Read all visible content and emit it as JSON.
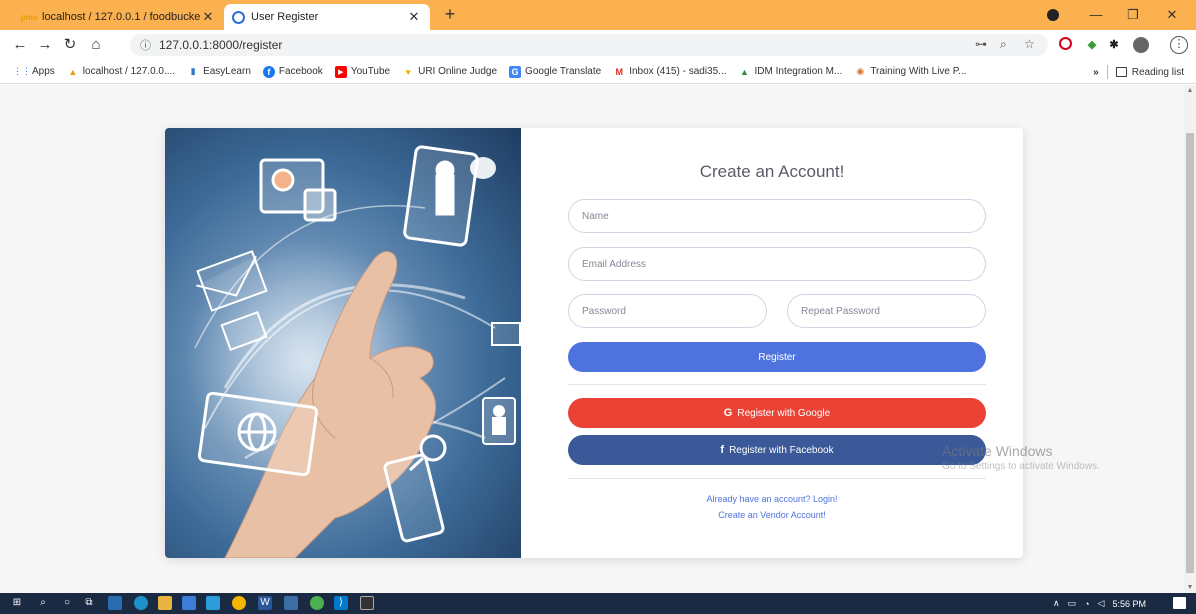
{
  "browser": {
    "tabs": [
      {
        "favicon": "phpmyadmin-icon",
        "favicon_text": "pma",
        "title": "localhost / 127.0.0.1 / foodbucke",
        "close": "✕"
      },
      {
        "favicon": "user-register-icon",
        "title": "User Register",
        "close": "✕"
      }
    ],
    "new_tab": "+",
    "window_controls": {
      "minimize": "—",
      "restore": "❐",
      "close": "✕"
    },
    "url": "127.0.0.1:8000/register",
    "url_info_icon": "ⓘ",
    "bookmarks": [
      {
        "label": "Apps",
        "icon": "apps-grid-icon",
        "glyph": "⋮⋮",
        "color": "#1a73e8"
      },
      {
        "label": "localhost / 127.0.0....",
        "icon": "phpmyadmin-icon",
        "glyph": "▲",
        "color": "#e8a000"
      },
      {
        "label": "EasyLearn",
        "icon": "easylearn-icon",
        "glyph": "▮",
        "color": "#2b78c5"
      },
      {
        "label": "Facebook",
        "icon": "facebook-icon",
        "glyph": "f",
        "color": "#1877f2"
      },
      {
        "label": "YouTube",
        "icon": "youtube-icon",
        "glyph": "▶",
        "color": "#ff0000"
      },
      {
        "label": "URI Online Judge",
        "icon": "uri-judge-icon",
        "glyph": "♥",
        "color": "#f4b400"
      },
      {
        "label": "Google Translate",
        "icon": "google-translate-icon",
        "glyph": "G",
        "color": "#4285f4"
      },
      {
        "label": "Inbox (415) - sadi35...",
        "icon": "gmail-icon",
        "glyph": "M",
        "color": "#d93025"
      },
      {
        "label": "IDM Integration M...",
        "icon": "idm-icon",
        "glyph": "▲",
        "color": "#2f8f3e"
      },
      {
        "label": "Training With Live P...",
        "icon": "training-icon",
        "glyph": "◉",
        "color": "#e07020"
      }
    ],
    "bookmarks_overflow": "»",
    "reading_list": "Reading list"
  },
  "page": {
    "heading": "Create an Account!",
    "fields": {
      "name_placeholder": "Name",
      "email_placeholder": "Email Address",
      "password_placeholder": "Password",
      "repeat_password_placeholder": "Repeat Password"
    },
    "buttons": {
      "register": "Register",
      "google_icon": "G",
      "google": "Register with Google",
      "facebook_icon": "f",
      "facebook": "Register with Facebook"
    },
    "links": {
      "login": "Already have an account? Login!",
      "vendor": "Create an Vendor Account!"
    },
    "colors": {
      "register": "#4e73df",
      "google": "#ea4335",
      "facebook": "#3b5998"
    }
  },
  "watermark": {
    "title": "Activate Windows",
    "subtitle": "Go to Settings to activate Windows."
  },
  "taskbar": {
    "time": "5:56 PM",
    "tray_icons": [
      "chevron-up-icon",
      "network-icon",
      "wifi-icon",
      "volume-icon"
    ]
  }
}
